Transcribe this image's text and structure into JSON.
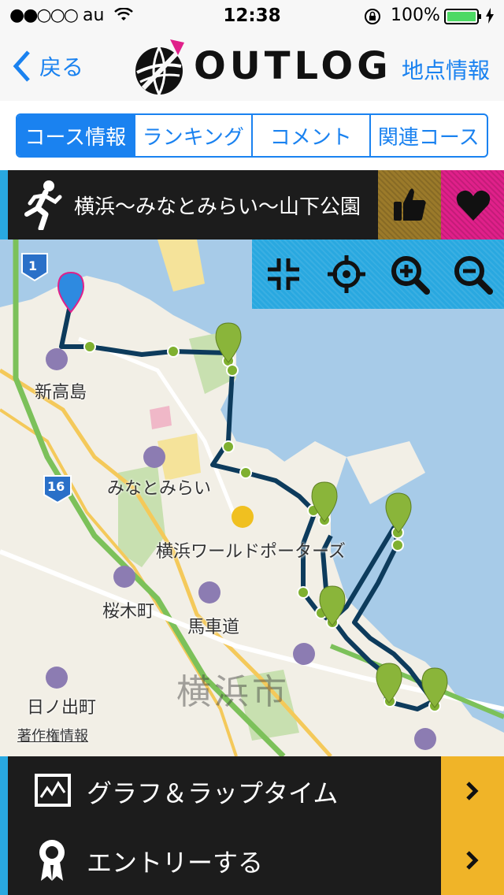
{
  "status": {
    "carrier": "au",
    "time": "12:38",
    "battery": "100%"
  },
  "nav": {
    "back": "戻る",
    "logo": "OUTLOG",
    "right": "地点情報"
  },
  "tabs": [
    "コース情報",
    "ランキング",
    "コメント",
    "関連コース"
  ],
  "course": {
    "title": "横浜〜みなとみらい〜山下公園"
  },
  "map": {
    "labels": {
      "shintakashima": "新高島",
      "minatomirai": "みなとみらい",
      "worldporters": "横浜ワールドポーターズ",
      "sakuragicho": "桜木町",
      "bashamichi": "馬車道",
      "hinodecho": "日ノ出町",
      "yokohamashi": "横浜市",
      "copyright": "著作権情報",
      "route1": "1",
      "route16": "16"
    }
  },
  "menu": {
    "graph": "グラフ＆ラップタイム",
    "entry": "エントリーする"
  },
  "colors": {
    "accent": "#1a82f0",
    "route": "#0d3b5c",
    "marker": "#7fb030",
    "like": "#9b7a2a",
    "fav": "#e0208a",
    "menu_arrow": "#f0b428"
  }
}
